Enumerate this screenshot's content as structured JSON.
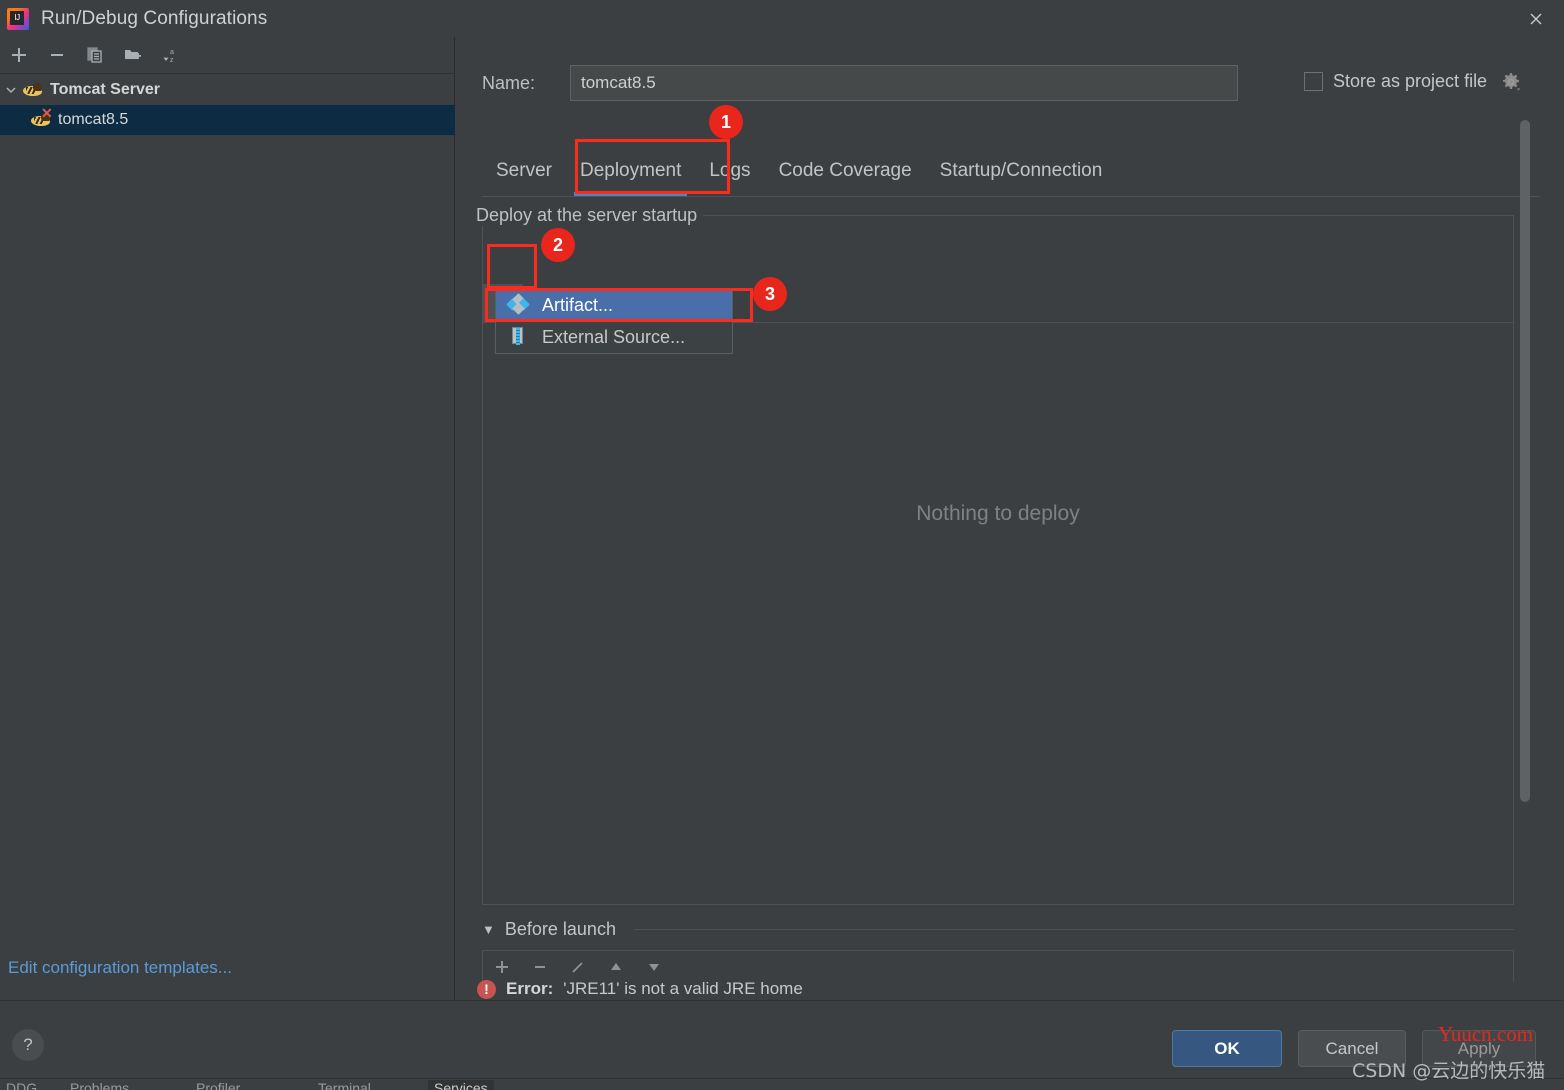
{
  "window": {
    "title": "Run/Debug Configurations",
    "logo_icon": "intellij-idea-logo",
    "close_icon": "close-icon"
  },
  "left_panel": {
    "toolbar": [
      {
        "name": "add-configuration",
        "icon": "plus-icon"
      },
      {
        "name": "remove-configuration",
        "icon": "minus-icon"
      },
      {
        "name": "copy-configuration",
        "icon": "copy-icon"
      },
      {
        "name": "new-folder",
        "icon": "folder-add-icon"
      },
      {
        "name": "sort-configurations",
        "icon": "sort-az-icon"
      }
    ],
    "tree": [
      {
        "label": "Tomcat Server",
        "icon": "tomcat-icon",
        "type": "group",
        "expanded": true
      },
      {
        "label": "tomcat8.5",
        "icon": "tomcat-error-icon",
        "type": "item",
        "selected": true
      }
    ],
    "edit_templates_link": "Edit configuration templates..."
  },
  "form": {
    "name_label": "Name:",
    "name_value": "tomcat8.5",
    "name_placeholder": "",
    "store_as_project_file_label": "Store as project file",
    "store_as_project_file_checked": false,
    "store_settings_icon": "gear-icon"
  },
  "tabs": [
    {
      "label": "Server",
      "active": false
    },
    {
      "label": "Deployment",
      "active": true
    },
    {
      "label": "Logs",
      "active": false
    },
    {
      "label": "Code Coverage",
      "active": false
    },
    {
      "label": "Startup/Connection",
      "active": false
    }
  ],
  "deployment": {
    "group_title": "Deploy at the server startup",
    "toolbar": [
      {
        "name": "add-deployment",
        "icon": "plus-icon",
        "state": "active"
      },
      {
        "name": "remove-deployment",
        "icon": "minus-icon",
        "state": "disabled"
      },
      {
        "name": "move-up",
        "icon": "arrow-up-icon",
        "state": "disabled"
      },
      {
        "name": "move-down",
        "icon": "arrow-down-icon",
        "state": "disabled"
      },
      {
        "name": "edit-deployment",
        "icon": "pencil-icon",
        "state": "disabled"
      }
    ],
    "empty_text": "Nothing to deploy",
    "popup_menu": [
      {
        "label": "Artifact...",
        "icon": "artifact-icon",
        "selected": true
      },
      {
        "label": "External Source...",
        "icon": "external-source-icon",
        "selected": false
      }
    ]
  },
  "before_launch": {
    "title": "Before launch",
    "expanded": true,
    "caret_icon": "triangle-down-icon",
    "toolbar": [
      {
        "name": "add-task",
        "icon": "plus-icon"
      },
      {
        "name": "remove-task",
        "icon": "minus-icon"
      },
      {
        "name": "edit-task",
        "icon": "pencil-icon"
      },
      {
        "name": "task-move-up",
        "icon": "arrow-up-icon"
      },
      {
        "name": "task-move-down",
        "icon": "arrow-down-icon"
      }
    ]
  },
  "status": {
    "error_icon": "error-icon",
    "error_label": "Error:",
    "error_message": "'JRE11' is not a valid JRE home"
  },
  "footer": {
    "help_label": "?",
    "ok_label": "OK",
    "cancel_label": "Cancel",
    "apply_label": "Apply"
  },
  "annotations": [
    {
      "number": "1",
      "target": "deployment-tab"
    },
    {
      "number": "2",
      "target": "add-deployment-button"
    },
    {
      "number": "3",
      "target": "artifact-menu-item"
    }
  ],
  "watermarks": {
    "site": "Yuucn.com",
    "author": "CSDN @云边的快乐猫"
  },
  "ide_status_bar": [
    {
      "label": "DDG"
    },
    {
      "label": "Problems"
    },
    {
      "label": "Profiler"
    },
    {
      "label": "Terminal"
    },
    {
      "label": "Services"
    }
  ],
  "colors": {
    "background": "#3c3f41",
    "accent_blue": "#4a88c7",
    "selection_blue": "#4a6ea9",
    "tree_selection": "#0d2b42",
    "ok_button": "#365880",
    "error_red": "#c75450",
    "annotation_red": "#e8261c",
    "link_blue": "#5a9bd8"
  }
}
